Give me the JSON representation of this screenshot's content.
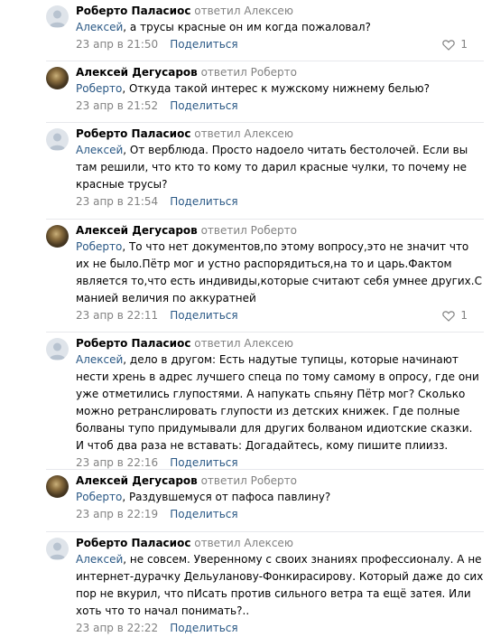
{
  "comments": [
    {
      "author": "Роберто Паласиос",
      "replied": "ответил Алексею",
      "mention": "Алексей",
      "text": ", а трусы красные он им когда пожаловал?",
      "date": "23 апр в 21:50",
      "share": "Поделиться",
      "likes": "1",
      "avatar": "default"
    },
    {
      "author": "Алексей Дегусаров",
      "replied": "ответил Роберто",
      "mention": "Роберто",
      "text": ", Откуда такой интерес к мужскому нижнему белью?",
      "date": "23 апр в 21:52",
      "share": "Поделиться",
      "avatar": "photo"
    },
    {
      "author": "Роберто Паласиос",
      "replied": "ответил Алексею",
      "mention": "Алексей",
      "text": ", От верблюда. Просто надоело читать бестолочей. Если вы там решили, что кто то кому то дарил красные чулки, то почему не красные трусы?",
      "date": "23 апр в 21:54",
      "share": "Поделиться",
      "avatar": "default"
    },
    {
      "author": "Алексей Дегусаров",
      "replied": "ответил Роберто",
      "mention": "Роберто",
      "text": ", То что нет документов,по этому вопросу,это не значит что их не было.Пётр мог и устно распорядиться,на то и царь.Фактом является то,что есть индивиды,которые считают себя умнее других.С манией величия по аккуратней",
      "date": "23 апр в 22:11",
      "share": "Поделиться",
      "likes": "1",
      "avatar": "photo"
    },
    {
      "author": "Роберто Паласиос",
      "replied": "ответил Алексею",
      "mention": "Алексей",
      "text": ", дело в другом: Есть надутые тупицы, которые начинают нести хрень в адрес лучшего спеца по тому самому в опросу, где они уже отметились глупостями. А напукать спьяну Пётр мог? Сколько можно ретранслировать глупости из детских книжек. Где полные болваны тупо придумывали для других болваном идиотские сказки. И чтоб два раза не вставать: Догадайтесь, кому пишите плиизз.",
      "date": "23 апр в 22:16",
      "share": "Поделиться",
      "avatar": "default"
    },
    {
      "author": "Алексей Дегусаров",
      "replied": "ответил Роберто",
      "mention": "Роберто",
      "text": ", Раздувшемуся от пафоса павлину?",
      "date": "23 апр в 22:19",
      "share": "Поделиться",
      "avatar": "photo"
    },
    {
      "author": "Роберто Паласиос",
      "replied": "ответил Алексею",
      "mention": "Алексей",
      "text": ", не совсем. Уверенному с своих знаниях профессионалу. А не интернет-дурачку Дельуланову-Фонкирасирову. Который даже до сих пор не вкурил, что пИсать против сильного ветра та ещё затея. Или хоть что то начал понимать?..",
      "date": "23 апр в 22:22",
      "share": "Поделиться",
      "avatar": "default"
    }
  ]
}
